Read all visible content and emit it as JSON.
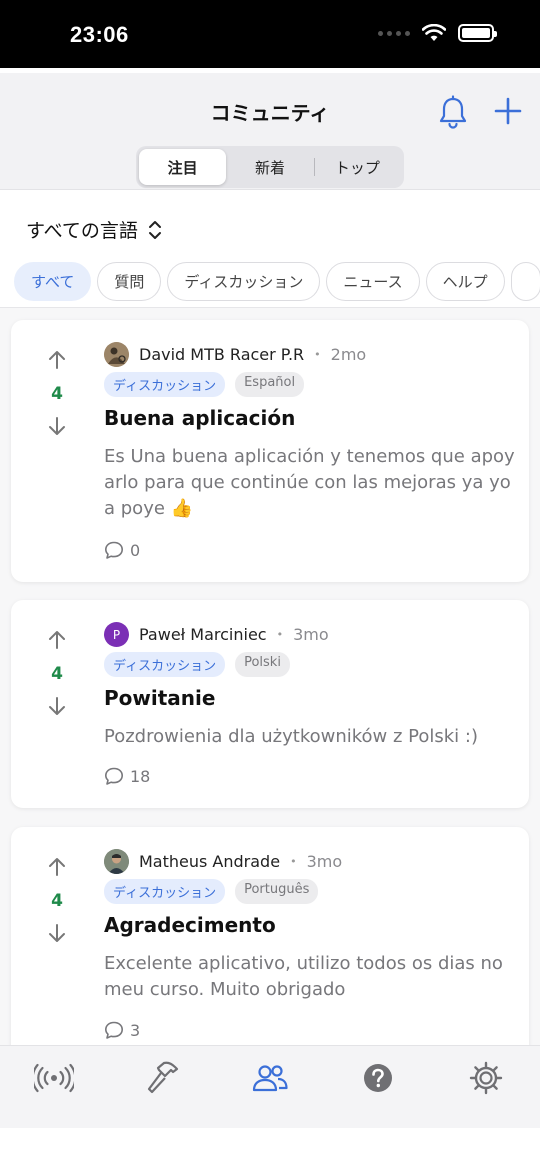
{
  "status_bar": {
    "time": "23:06"
  },
  "header": {
    "title": "コミュニティ",
    "tabs": [
      {
        "label": "注目",
        "active": true
      },
      {
        "label": "新着",
        "active": false
      },
      {
        "label": "トップ",
        "active": false
      }
    ],
    "icons": [
      "bell-icon",
      "plus-icon"
    ]
  },
  "language_selector": {
    "label": "すべての言語"
  },
  "filters": [
    "すべて",
    "質問",
    "ディスカッション",
    "ニュース",
    "ヘルプ"
  ],
  "posts": [
    {
      "author": "David MTB Racer P.R",
      "avatar": "photo",
      "ago": "2mo",
      "category": "ディスカッション",
      "language": "Español",
      "votes": "4",
      "title": "Buena aplicación",
      "body": "Es Una buena aplicación y tenemos que apoy arlo para que continúe con las mejoras ya yo a poye 👍",
      "comments": "0"
    },
    {
      "author": "Paweł Marciniec",
      "avatar": "P",
      "avatar_color": "#7b2fb5",
      "ago": "3mo",
      "category": "ディスカッション",
      "language": "Polski",
      "votes": "4",
      "title": "Powitanie",
      "body": "Pozdrowienia dla użytkowników z Polski :)",
      "comments": "18"
    },
    {
      "author": "Matheus Andrade",
      "avatar": "photo",
      "ago": "3mo",
      "category": "ディスカッション",
      "language": "Português",
      "votes": "4",
      "title": "Agradecimento",
      "body": "Excelente aplicativo, utilizo todos os dias no meu curso. Muito obrigado",
      "comments": "3"
    }
  ],
  "tab_bar": {
    "items": [
      "broadcast-icon",
      "hammer-icon",
      "community-icon",
      "help-icon",
      "settings-icon"
    ],
    "active": "community-icon"
  },
  "colors": {
    "accent": "#3b6fd8",
    "vote": "#1f8a4a",
    "muted": "#77777b"
  }
}
